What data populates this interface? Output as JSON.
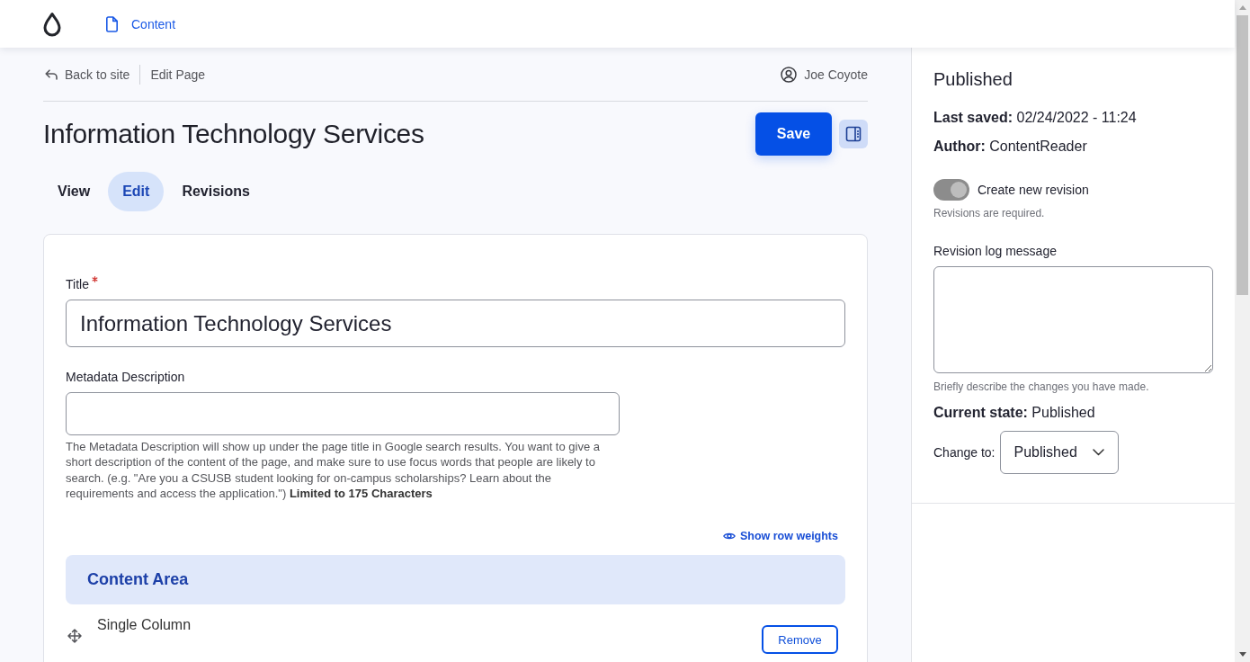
{
  "top_bar": {
    "nav": [
      {
        "label": "Content"
      }
    ]
  },
  "breadcrumb": {
    "back_link": "Back to site",
    "current": "Edit Page",
    "user": "Joe Coyote"
  },
  "page_header": {
    "title": "Information Technology Services",
    "save_button": "Save"
  },
  "tabs": [
    {
      "label": "View",
      "selected": false
    },
    {
      "label": "Edit",
      "selected": true
    },
    {
      "label": "Revisions",
      "selected": false
    }
  ],
  "form": {
    "fields": [
      {
        "kind": "title",
        "label": "Title",
        "required": true,
        "value": "Information Technology Services"
      },
      {
        "kind": "text",
        "label": "Metadata Description",
        "required": false,
        "description": "The Metadata Description will show up under the page title in Google search results. You want to give a short description of the content of the page, and make sure to use focus words that people are likely to search. (e.g. \"Are you a CSUSB student looking for on-campus scholarships? Learn about the requirements and access the application.\") **Limited to 175 Characters**"
      }
    ],
    "row_weights_link": "Show row weights",
    "section": {
      "title": "Content Area",
      "rows": [
        {
          "label": "Single Column",
          "remove_button": "Remove"
        }
      ]
    }
  },
  "sidebar": {
    "status": "Published",
    "meta": [
      "**Last saved:** 02/24/2022 - 11:24",
      "**Author:** ContentReader"
    ],
    "revision_toggle": {
      "label": "Create new revision",
      "on": true,
      "disabled": true,
      "description": "Revisions are required."
    },
    "log": {
      "label": "Revision log message",
      "description": "Briefly describe the changes you have made."
    },
    "current_state": "**Current state:** Published",
    "change_to": {
      "label": "Change to:",
      "value": "Published"
    }
  }
}
